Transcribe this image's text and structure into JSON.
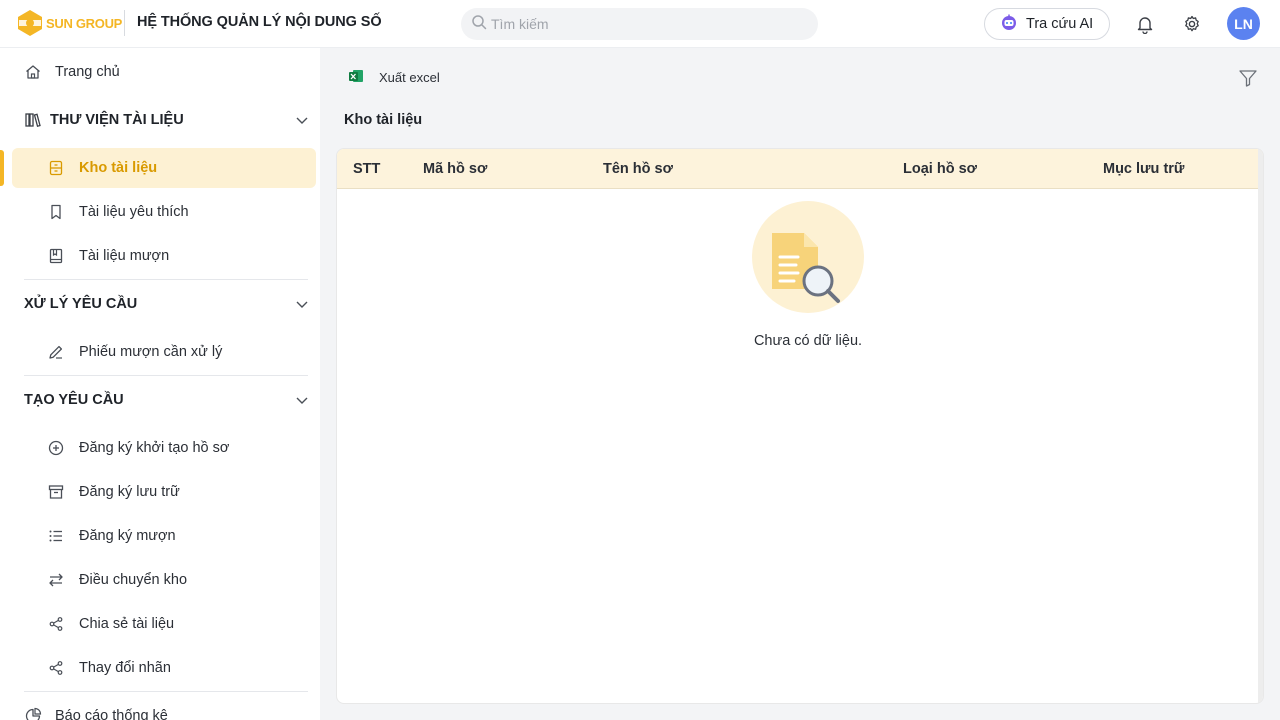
{
  "header": {
    "logo_text": "SUN GROUP",
    "app_title": "HỆ THỐNG QUẢN LÝ NỘI DUNG SỐ",
    "search_placeholder": "Tìm kiếm",
    "ai_button_label": "Tra cứu AI",
    "avatar_initials": "LN"
  },
  "sidebar": {
    "home": "Trang chủ",
    "sections": [
      {
        "title": "THƯ VIỆN TÀI LIỆU",
        "items": [
          "Kho tài liệu",
          "Tài liệu yêu thích",
          "Tài liệu mượn"
        ]
      },
      {
        "title": "XỬ LÝ YÊU CẦU",
        "items": [
          "Phiếu mượn cần xử lý"
        ]
      },
      {
        "title": "TẠO YÊU CẦU",
        "items": [
          "Đăng ký khởi tạo hồ sơ",
          "Đăng ký lưu trữ",
          "Đăng ký mượn",
          "Điều chuyển kho",
          "Chia sẻ tài liệu",
          "Thay đổi nhãn"
        ]
      }
    ],
    "report": "Báo cáo thống kê",
    "active_item": "Kho tài liệu"
  },
  "main": {
    "export_label": "Xuất excel",
    "page_title": "Kho tài liệu",
    "table": {
      "columns": [
        "STT",
        "Mã hồ sơ",
        "Tên hồ sơ",
        "Loại hồ sơ",
        "Mục lưu trữ"
      ],
      "rows": []
    },
    "empty_text": "Chưa có dữ liệu."
  },
  "colors": {
    "accent": "#f4b625",
    "active_bg": "#fdf1d3",
    "active_text": "#d99a00",
    "table_header_bg": "#fdf3dc",
    "avatar_bg": "#5b82f0"
  }
}
